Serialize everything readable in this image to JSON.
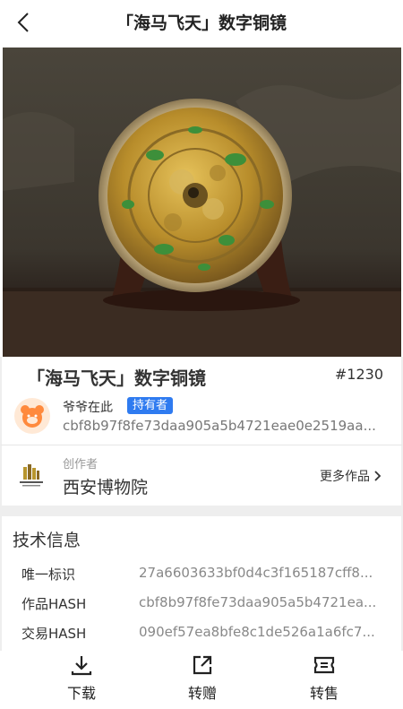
{
  "header": {
    "title": "「海马飞天」数字铜镜"
  },
  "item": {
    "title": "「海马飞天」数字铜镜",
    "number": "#1230"
  },
  "owner": {
    "name": "爷爷在此",
    "badge": "持有者",
    "hash": "cbf8b97f8fe73daa905a5b4721eae0e2519aa..."
  },
  "creator": {
    "caption": "创作者",
    "name": "西安博物院",
    "more_label": "更多作品"
  },
  "tech": {
    "title": "技术信息",
    "rows": [
      {
        "key": "唯一标识",
        "value": "27a6603633bf0d4c3f165187cff8..."
      },
      {
        "key": "作品HASH",
        "value": "cbf8b97f8fe73daa905a5b4721ea..."
      },
      {
        "key": "交易HASH",
        "value": "090ef57ea8bfe8c1de526a1a6fc7..."
      }
    ]
  },
  "actions": [
    {
      "label": "下载",
      "icon": "download-icon"
    },
    {
      "label": "转赠",
      "icon": "share-icon"
    },
    {
      "label": "转售",
      "icon": "ticket-icon"
    }
  ],
  "colors": {
    "accent": "#2f7bf0",
    "band": "#eeeeee",
    "mirror_gold": "#c9a33b"
  }
}
